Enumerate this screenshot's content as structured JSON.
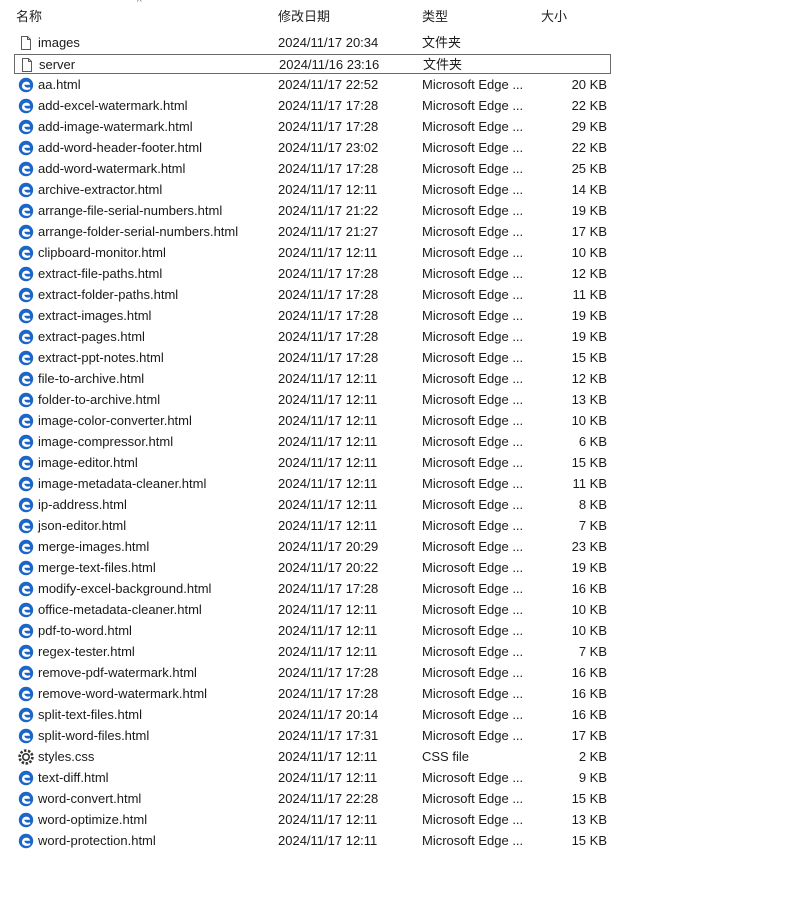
{
  "columns": {
    "name": "名称",
    "date": "修改日期",
    "type": "类型",
    "size": "大小"
  },
  "colors": {
    "edge_icon": "#1b66c9",
    "selected_border": "#6b6b6b"
  },
  "files": [
    {
      "name": "images",
      "date": "2024/11/17 20:34",
      "type": "文件夹",
      "size": "",
      "icon": "folder-icon"
    },
    {
      "name": "server",
      "date": "2024/11/16 23:16",
      "type": "文件夹",
      "size": "",
      "icon": "folder-icon",
      "selected": true
    },
    {
      "name": "aa.html",
      "date": "2024/11/17 22:52",
      "type": "Microsoft Edge ...",
      "size": "20 KB",
      "icon": "edge-icon"
    },
    {
      "name": "add-excel-watermark.html",
      "date": "2024/11/17 17:28",
      "type": "Microsoft Edge ...",
      "size": "22 KB",
      "icon": "edge-icon"
    },
    {
      "name": "add-image-watermark.html",
      "date": "2024/11/17 17:28",
      "type": "Microsoft Edge ...",
      "size": "29 KB",
      "icon": "edge-icon"
    },
    {
      "name": "add-word-header-footer.html",
      "date": "2024/11/17 23:02",
      "type": "Microsoft Edge ...",
      "size": "22 KB",
      "icon": "edge-icon"
    },
    {
      "name": "add-word-watermark.html",
      "date": "2024/11/17 17:28",
      "type": "Microsoft Edge ...",
      "size": "25 KB",
      "icon": "edge-icon"
    },
    {
      "name": "archive-extractor.html",
      "date": "2024/11/17 12:11",
      "type": "Microsoft Edge ...",
      "size": "14 KB",
      "icon": "edge-icon"
    },
    {
      "name": "arrange-file-serial-numbers.html",
      "date": "2024/11/17 21:22",
      "type": "Microsoft Edge ...",
      "size": "19 KB",
      "icon": "edge-icon"
    },
    {
      "name": "arrange-folder-serial-numbers.html",
      "date": "2024/11/17 21:27",
      "type": "Microsoft Edge ...",
      "size": "17 KB",
      "icon": "edge-icon"
    },
    {
      "name": "clipboard-monitor.html",
      "date": "2024/11/17 12:11",
      "type": "Microsoft Edge ...",
      "size": "10 KB",
      "icon": "edge-icon"
    },
    {
      "name": "extract-file-paths.html",
      "date": "2024/11/17 17:28",
      "type": "Microsoft Edge ...",
      "size": "12 KB",
      "icon": "edge-icon"
    },
    {
      "name": "extract-folder-paths.html",
      "date": "2024/11/17 17:28",
      "type": "Microsoft Edge ...",
      "size": "11 KB",
      "icon": "edge-icon"
    },
    {
      "name": "extract-images.html",
      "date": "2024/11/17 17:28",
      "type": "Microsoft Edge ...",
      "size": "19 KB",
      "icon": "edge-icon"
    },
    {
      "name": "extract-pages.html",
      "date": "2024/11/17 17:28",
      "type": "Microsoft Edge ...",
      "size": "19 KB",
      "icon": "edge-icon"
    },
    {
      "name": "extract-ppt-notes.html",
      "date": "2024/11/17 17:28",
      "type": "Microsoft Edge ...",
      "size": "15 KB",
      "icon": "edge-icon"
    },
    {
      "name": "file-to-archive.html",
      "date": "2024/11/17 12:11",
      "type": "Microsoft Edge ...",
      "size": "12 KB",
      "icon": "edge-icon"
    },
    {
      "name": "folder-to-archive.html",
      "date": "2024/11/17 12:11",
      "type": "Microsoft Edge ...",
      "size": "13 KB",
      "icon": "edge-icon"
    },
    {
      "name": "image-color-converter.html",
      "date": "2024/11/17 12:11",
      "type": "Microsoft Edge ...",
      "size": "10 KB",
      "icon": "edge-icon"
    },
    {
      "name": "image-compressor.html",
      "date": "2024/11/17 12:11",
      "type": "Microsoft Edge ...",
      "size": "6 KB",
      "icon": "edge-icon"
    },
    {
      "name": "image-editor.html",
      "date": "2024/11/17 12:11",
      "type": "Microsoft Edge ...",
      "size": "15 KB",
      "icon": "edge-icon"
    },
    {
      "name": "image-metadata-cleaner.html",
      "date": "2024/11/17 12:11",
      "type": "Microsoft Edge ...",
      "size": "11 KB",
      "icon": "edge-icon"
    },
    {
      "name": "ip-address.html",
      "date": "2024/11/17 12:11",
      "type": "Microsoft Edge ...",
      "size": "8 KB",
      "icon": "edge-icon"
    },
    {
      "name": "json-editor.html",
      "date": "2024/11/17 12:11",
      "type": "Microsoft Edge ...",
      "size": "7 KB",
      "icon": "edge-icon"
    },
    {
      "name": "merge-images.html",
      "date": "2024/11/17 20:29",
      "type": "Microsoft Edge ...",
      "size": "23 KB",
      "icon": "edge-icon"
    },
    {
      "name": "merge-text-files.html",
      "date": "2024/11/17 20:22",
      "type": "Microsoft Edge ...",
      "size": "19 KB",
      "icon": "edge-icon"
    },
    {
      "name": "modify-excel-background.html",
      "date": "2024/11/17 17:28",
      "type": "Microsoft Edge ...",
      "size": "16 KB",
      "icon": "edge-icon"
    },
    {
      "name": "office-metadata-cleaner.html",
      "date": "2024/11/17 12:11",
      "type": "Microsoft Edge ...",
      "size": "10 KB",
      "icon": "edge-icon"
    },
    {
      "name": "pdf-to-word.html",
      "date": "2024/11/17 12:11",
      "type": "Microsoft Edge ...",
      "size": "10 KB",
      "icon": "edge-icon"
    },
    {
      "name": "regex-tester.html",
      "date": "2024/11/17 12:11",
      "type": "Microsoft Edge ...",
      "size": "7 KB",
      "icon": "edge-icon"
    },
    {
      "name": "remove-pdf-watermark.html",
      "date": "2024/11/17 17:28",
      "type": "Microsoft Edge ...",
      "size": "16 KB",
      "icon": "edge-icon"
    },
    {
      "name": "remove-word-watermark.html",
      "date": "2024/11/17 17:28",
      "type": "Microsoft Edge ...",
      "size": "16 KB",
      "icon": "edge-icon"
    },
    {
      "name": "split-text-files.html",
      "date": "2024/11/17 20:14",
      "type": "Microsoft Edge ...",
      "size": "16 KB",
      "icon": "edge-icon"
    },
    {
      "name": "split-word-files.html",
      "date": "2024/11/17 17:31",
      "type": "Microsoft Edge ...",
      "size": "17 KB",
      "icon": "edge-icon"
    },
    {
      "name": "styles.css",
      "date": "2024/11/17 12:11",
      "type": "CSS file",
      "size": "2 KB",
      "icon": "css-settings-icon"
    },
    {
      "name": "text-diff.html",
      "date": "2024/11/17 12:11",
      "type": "Microsoft Edge ...",
      "size": "9 KB",
      "icon": "edge-icon"
    },
    {
      "name": "word-convert.html",
      "date": "2024/11/17 22:28",
      "type": "Microsoft Edge ...",
      "size": "15 KB",
      "icon": "edge-icon"
    },
    {
      "name": "word-optimize.html",
      "date": "2024/11/17 12:11",
      "type": "Microsoft Edge ...",
      "size": "13 KB",
      "icon": "edge-icon"
    },
    {
      "name": "word-protection.html",
      "date": "2024/11/17 12:11",
      "type": "Microsoft Edge ...",
      "size": "15 KB",
      "icon": "edge-icon"
    }
  ]
}
